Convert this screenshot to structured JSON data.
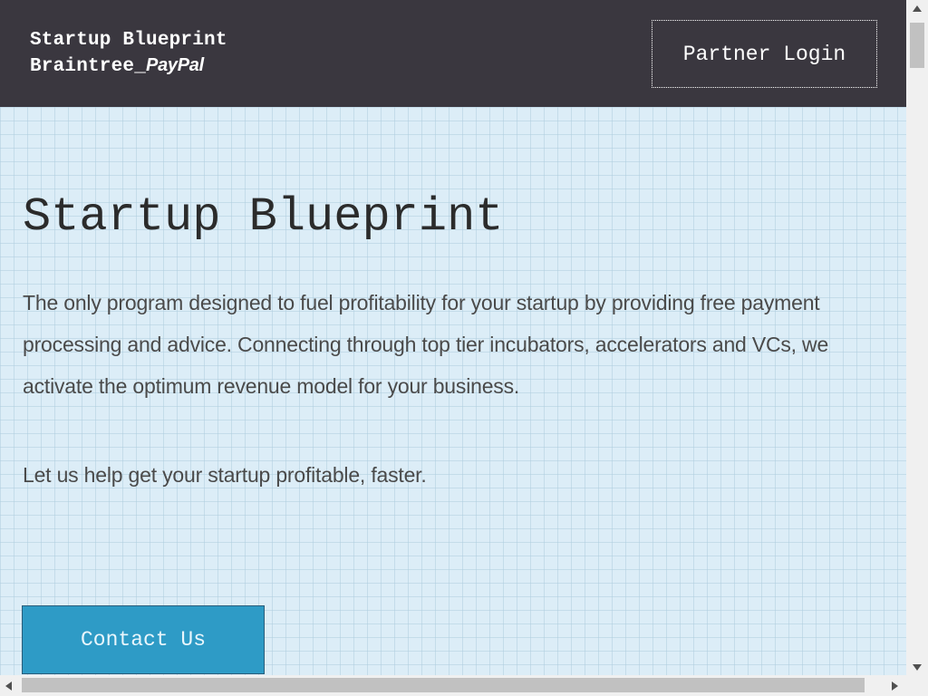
{
  "header": {
    "brand_title": "Startup Blueprint",
    "brand_braintree": "Braintree_",
    "brand_paypal": "PayPal",
    "partner_login_label": "Partner Login"
  },
  "hero": {
    "title": "Startup Blueprint",
    "description": "The only program designed to fuel profitability for your startup by providing free payment processing and advice. Connecting through top tier incubators, accelerators and VCs, we activate the optimum revenue model for your business.",
    "tagline": "Let us help get your startup profitable, faster.",
    "contact_label": "Contact Us"
  },
  "colors": {
    "header_bg": "#3a373f",
    "hero_bg": "#dcedf7",
    "accent": "#2e9bc6"
  },
  "icons": {
    "scroll_up": "triangle-up-icon",
    "scroll_down": "triangle-down-icon",
    "scroll_left": "triangle-left-icon",
    "scroll_right": "triangle-right-icon"
  }
}
